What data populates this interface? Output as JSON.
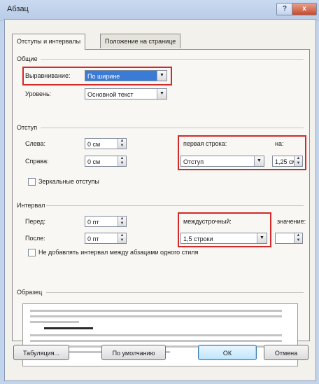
{
  "window": {
    "title": "Абзац",
    "help": "?",
    "close": "x"
  },
  "tabs": [
    {
      "label": "Отступы и интервалы"
    },
    {
      "label": "Положение на странице"
    }
  ],
  "general": {
    "heading": "Общие",
    "alignment_label": "Выравнивание:",
    "alignment_value": "По ширине",
    "level_label": "Уровень:",
    "level_value": "Основной текст"
  },
  "indent": {
    "heading": "Отступ",
    "left_label": "Слева:",
    "left_value": "0 см",
    "right_label": "Справа:",
    "right_value": "0 см",
    "first_line_label": "первая строка:",
    "first_line_value": "Отступ",
    "by_label": "на:",
    "by_value": "1,25 см",
    "mirror_label": "Зеркальные отступы"
  },
  "spacing": {
    "heading": "Интервал",
    "before_label": "Перед:",
    "before_value": "0 пт",
    "after_label": "После:",
    "after_value": "0 пт",
    "line_label": "междустрочный:",
    "line_value": "1,5 строки",
    "at_label": "значение:",
    "at_value": "",
    "no_space_label": "Не добавлять интервал между абзацами одного стиля"
  },
  "sample": {
    "heading": "Образец"
  },
  "buttons": {
    "tabs": "Табуляция...",
    "default": "По умолчанию",
    "ok": "ОК",
    "cancel": "Отмена"
  },
  "colors": {
    "highlight": "#d12a2a",
    "selection": "#3a7bd5"
  }
}
